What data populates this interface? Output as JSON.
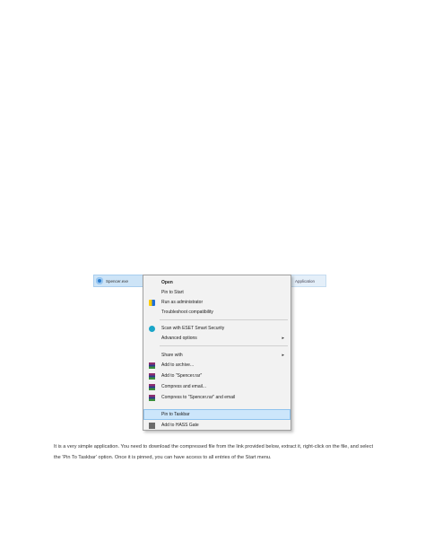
{
  "file": {
    "name": "Spencer.exe",
    "type": "Application"
  },
  "menu": {
    "items": [
      {
        "label": "Open",
        "icon": "",
        "bold": true
      },
      {
        "label": "Pin to Start",
        "icon": ""
      },
      {
        "label": "Run as administrator",
        "icon": "uac-shield-icon"
      },
      {
        "label": "Troubleshoot compatibility",
        "icon": ""
      },
      {
        "label": "Scan with ESET Smart Security",
        "icon": "eset-icon"
      },
      {
        "label": "Advanced options",
        "icon": "",
        "submenu": true
      },
      {
        "label": "Share with",
        "icon": "",
        "submenu": true
      },
      {
        "label": "Add to archive...",
        "icon": "winrar-icon"
      },
      {
        "label": "Add to \"Spencer.rar\"",
        "icon": "winrar-icon"
      },
      {
        "label": "Compress and email...",
        "icon": "winrar-icon"
      },
      {
        "label": "Compress to \"Spencer.rar\" and email",
        "icon": "winrar-icon"
      },
      {
        "label": "Pin to Taskbar",
        "icon": "",
        "highlighted": true
      },
      {
        "label": "Add to HASS Gate",
        "icon": "hash-icon"
      }
    ],
    "submenu_arrow": "▸"
  },
  "caption": "It is a very simple application. You need to download the compressed file from the link provided below, extract it, right-click on the file, and select the 'Pin To Taskbar' option. Once it is pinned, you can have access to all entries of the Start menu."
}
